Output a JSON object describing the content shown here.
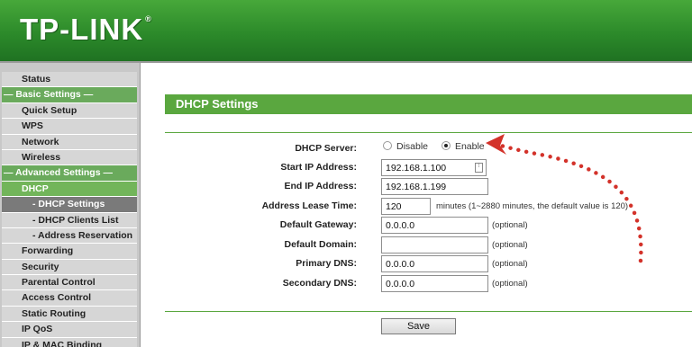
{
  "header": {
    "logo": "TP-LINK",
    "logo_tm": "®"
  },
  "sidebar": {
    "items": [
      {
        "label": "Status",
        "type": "item"
      },
      {
        "label": "— Basic Settings —",
        "type": "section"
      },
      {
        "label": "Quick Setup",
        "type": "item"
      },
      {
        "label": "WPS",
        "type": "item"
      },
      {
        "label": "Network",
        "type": "item"
      },
      {
        "label": "Wireless",
        "type": "item"
      },
      {
        "label": "— Advanced Settings —",
        "type": "section"
      },
      {
        "label": "DHCP",
        "type": "active"
      },
      {
        "label": "- DHCP Settings",
        "type": "sub-active"
      },
      {
        "label": "- DHCP Clients List",
        "type": "sub"
      },
      {
        "label": "- Address Reservation",
        "type": "sub"
      },
      {
        "label": "Forwarding",
        "type": "item"
      },
      {
        "label": "Security",
        "type": "item"
      },
      {
        "label": "Parental Control",
        "type": "item"
      },
      {
        "label": "Access Control",
        "type": "item"
      },
      {
        "label": "Static Routing",
        "type": "item"
      },
      {
        "label": "IP QoS",
        "type": "item"
      },
      {
        "label": "IP & MAC Binding",
        "type": "item"
      }
    ]
  },
  "main": {
    "title": "DHCP Settings",
    "dhcp_server": {
      "label": "DHCP Server:",
      "options": [
        "Disable",
        "Enable"
      ],
      "selected": "Enable"
    },
    "start_ip": {
      "label": "Start IP Address:",
      "value": "192.168.1.100"
    },
    "end_ip": {
      "label": "End IP Address:",
      "value": "192.168.1.199"
    },
    "lease_time": {
      "label": "Address Lease Time:",
      "value": "120",
      "note": "minutes (1~2880 minutes, the default value is 120)"
    },
    "gateway": {
      "label": "Default Gateway:",
      "value": "0.0.0.0",
      "note": "(optional)"
    },
    "domain": {
      "label": "Default Domain:",
      "value": "",
      "note": "(optional)"
    },
    "primary_dns": {
      "label": "Primary DNS:",
      "value": "0.0.0.0",
      "note": "(optional)"
    },
    "secondary_dns": {
      "label": "Secondary DNS:",
      "value": "0.0.0.0",
      "note": "(optional)"
    },
    "save_label": "Save"
  },
  "colors": {
    "brand_green": "#2c8a2a",
    "accent_green": "#5aa73f",
    "arrow_red": "#d3322a"
  }
}
